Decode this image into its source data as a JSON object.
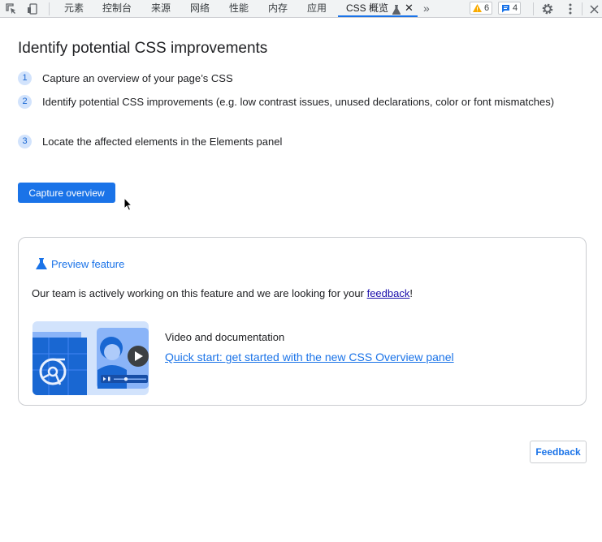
{
  "toolbar": {
    "tabs": [
      "元素",
      "控制台",
      "来源",
      "网络",
      "性能",
      "内存",
      "应用"
    ],
    "active_tab": "CSS 概览",
    "warnings_count": "6",
    "messages_count": "4"
  },
  "main": {
    "title": "Identify potential CSS improvements",
    "steps": [
      {
        "num": "1",
        "text": "Capture an overview of your page’s CSS"
      },
      {
        "num": "2",
        "text": "Identify potential CSS improvements (e.g. low contrast issues, unused declarations, color or font mismatches)"
      },
      {
        "num": "3",
        "text": "Locate the affected elements in the Elements panel"
      }
    ],
    "capture_button": "Capture overview"
  },
  "preview": {
    "heading": "Preview feature",
    "text_before": "Our team is actively working on this feature and we are looking for your ",
    "link": "feedback",
    "text_after": "!",
    "video_label": "Video and documentation",
    "video_link": "Quick start: get started with the new CSS Overview panel"
  },
  "feedback_button": "Feedback",
  "colors": {
    "accent": "#1a73e8",
    "warning": "#f9ab00",
    "link_visited": "#1a0dab"
  }
}
